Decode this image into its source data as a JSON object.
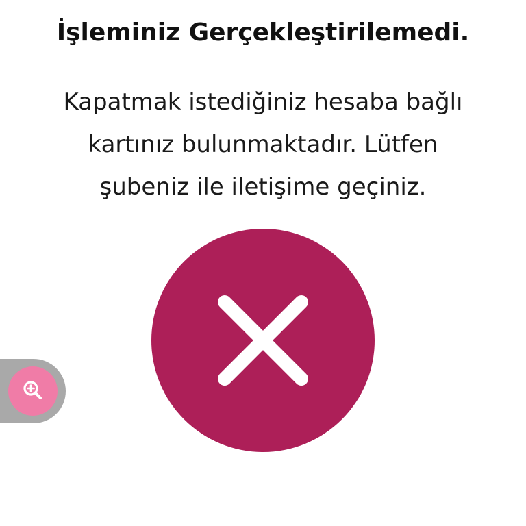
{
  "dialog": {
    "title": "İşleminiz Gerçekleştirilemedi.",
    "message_lines": [
      "Kapatmak istediğiniz hesaba bağlı",
      "kartınız bulunmaktadır. Lütfen",
      "şubeniz ile iletişime geçiniz."
    ],
    "status_icon": "close-icon",
    "status_color": "#ad1f58"
  },
  "accessibility": {
    "zoom_icon": "zoom-in-icon",
    "tab_color": "#a9a9a9",
    "button_color": "#f07ca7"
  }
}
